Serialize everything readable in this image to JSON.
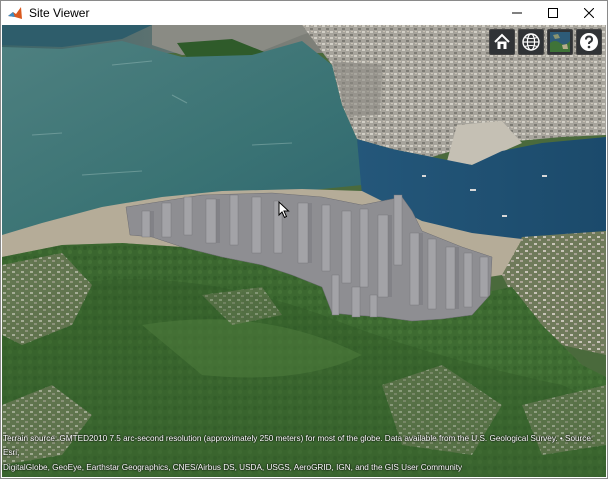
{
  "window": {
    "title": "Site Viewer",
    "controls": [
      "minimize",
      "maximize",
      "close"
    ]
  },
  "toolbar": {
    "buttons": [
      {
        "icon": "home-icon",
        "label": "Home"
      },
      {
        "icon": "globe-icon",
        "label": "Scene mode"
      },
      {
        "icon": "basemap-icon",
        "label": "Base layer picker"
      },
      {
        "icon": "help-icon",
        "label": "Navigation instructions"
      }
    ]
  },
  "credits": {
    "line1": "Terrain source: GMTED2010 7.5 arc-second resolution (approximately 250 meters) for most of the globe. Data available from the U.S. Geological Survey. • Source: Esri,",
    "line2": "DigitalGlobe, GeoEye, Earthstar Geographics, CNES/Airbus DS, USDA, USGS, AeroGRID, IGN, and the GIS User Community"
  },
  "colors": {
    "toolbar_bg": "#303336",
    "sea": "#3d7378",
    "sea_dark": "#1f4e6e",
    "vegetation": "#3c6a2f",
    "buildings": "#8f8f93"
  }
}
